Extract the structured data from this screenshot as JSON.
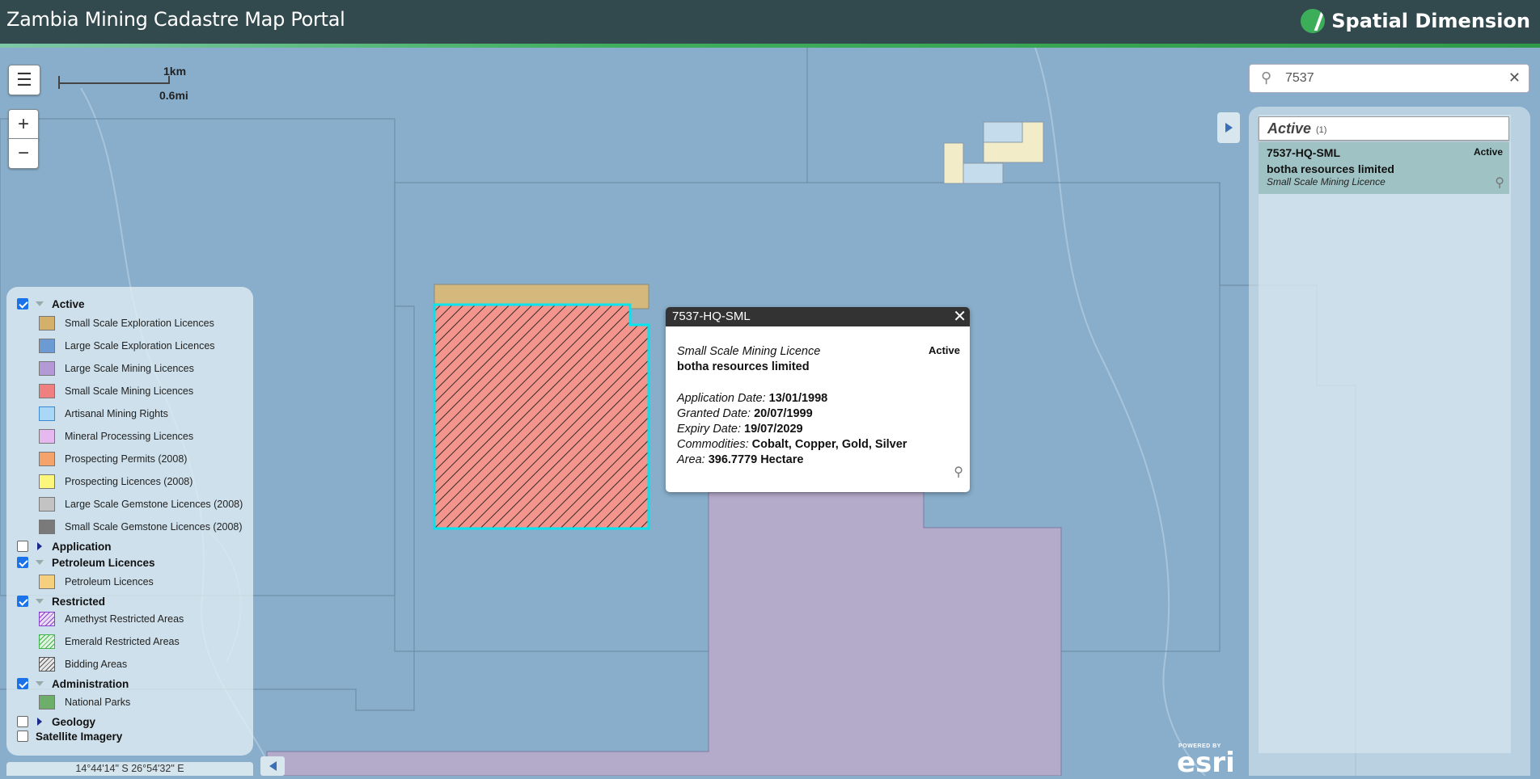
{
  "header": {
    "title": "Zambia Mining Cadastre Map Portal",
    "brand": "Spatial Dimension"
  },
  "map": {
    "scale": {
      "km": "1km",
      "mi": "0.6mi"
    },
    "coords": "14°44'14\" S  26°54'32\" E",
    "zoom_in": "+",
    "zoom_out": "−",
    "menu_icon": "hamburger-icon",
    "esri": {
      "powered": "POWERED BY",
      "brand": "esri"
    }
  },
  "legend": {
    "active": {
      "label": "Active",
      "checked": true,
      "items": [
        {
          "label": "Small Scale Exploration Licences",
          "color": "#d4b06a"
        },
        {
          "label": "Large Scale Exploration Licences",
          "color": "#6b9bd2"
        },
        {
          "label": "Large Scale Mining Licences",
          "color": "#b39ad6"
        },
        {
          "label": "Small Scale Mining Licences",
          "color": "#f08080"
        },
        {
          "label": "Artisanal Mining Rights",
          "color": "#a9d7f5"
        },
        {
          "label": "Mineral Processing Licences",
          "color": "#e6b8f0"
        },
        {
          "label": "Prospecting Permits (2008)",
          "color": "#f4a46a"
        },
        {
          "label": "Prospecting Licences (2008)",
          "color": "#fbf67c"
        },
        {
          "label": "Large Scale Gemstone Licences (2008)",
          "color": "#c3c3c3"
        },
        {
          "label": "Small Scale Gemstone Licences (2008)",
          "color": "#7a7a7a"
        }
      ]
    },
    "application": {
      "label": "Application",
      "checked": false
    },
    "petroleum": {
      "label": "Petroleum Licences",
      "checked": true,
      "items": [
        {
          "label": "Petroleum Licences",
          "color": "#f6cf7e"
        }
      ]
    },
    "restricted": {
      "label": "Restricted",
      "checked": true,
      "items": [
        {
          "label": "Amethyst Restricted Areas",
          "color": "#8a3fd0"
        },
        {
          "label": "Emerald Restricted Areas",
          "color": "#3fb54a"
        },
        {
          "label": "Bidding Areas",
          "color": "#555555"
        }
      ]
    },
    "administration": {
      "label": "Administration",
      "checked": true,
      "items": [
        {
          "label": "National Parks",
          "color": "#6cae6a"
        }
      ]
    },
    "geology": {
      "label": "Geology",
      "checked": false
    },
    "satellite": {
      "label": "Satellite Imagery",
      "checked": false
    }
  },
  "popup": {
    "title": "7537-HQ-SML",
    "type": "Small Scale Mining Licence",
    "status": "Active",
    "holder": "botha resources limited",
    "application_label": "Application Date:",
    "application_date": "13/01/1998",
    "granted_label": "Granted Date:",
    "granted_date": "20/07/1999",
    "expiry_label": "Expiry Date:",
    "expiry_date": "19/07/2029",
    "commodities_label": "Commodities:",
    "commodities": "Cobalt, Copper, Gold, Silver",
    "area_label": "Area:",
    "area": "396.7779 Hectare"
  },
  "search": {
    "value": "7537"
  },
  "results": {
    "group": "Active",
    "count": "(1)",
    "items": [
      {
        "code": "7537-HQ-SML",
        "status": "Active",
        "holder": "botha resources limited",
        "type": "Small Scale Mining Licence"
      }
    ]
  }
}
